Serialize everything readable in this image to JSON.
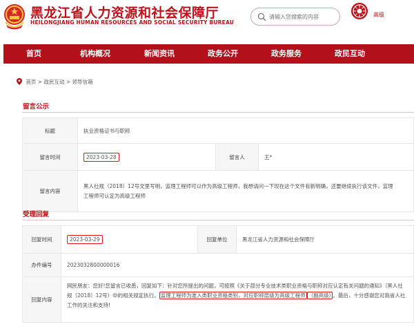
{
  "header": {
    "title": "黑龙江省人力资源和社会保障厅",
    "subtitle": "HEILONGJIANG HUMAN RESOURCES AND SOCIAL SECURITY BUREAU",
    "search_placeholder": "请输入您搜索的内容",
    "seal_label": "高级",
    "accent_color": "#b2111b"
  },
  "nav": {
    "items": [
      "首页",
      "机构概况",
      "新闻资讯",
      "政务公开",
      "政务服务",
      "政民互动"
    ]
  },
  "breadcrumb": {
    "home": "首页",
    "sep1": ">",
    "level1": "政民互动",
    "sep2": ">",
    "level2": "领导信箱"
  },
  "message": {
    "section_title": "留言公示",
    "title_label": "标题",
    "title_value": "执业资格证书与职称",
    "time_label": "留言时间",
    "time_value": "2023-03-28",
    "person_label": "留言人",
    "person_value": "王*",
    "content_label": "留言内容",
    "content_value": "黑人社规（2018）12号文里写明，监理工程师可以作为高级工程师，我想请问一下现在这个文件有新明确，还要继续执行该文件，监理工程师可认定为高级工程师"
  },
  "reply": {
    "section_title": "受理回复",
    "time_label": "回复时间",
    "time_value": "2023-03-29",
    "unit_label": "回复单位",
    "unit_value": "黑龙江省人力资源和社会保障厅",
    "id_label": "办件编号",
    "id_value": "2023032800000016",
    "content_label": "回复内容",
    "content_part1": "网民朋友：您好!您留言已收悉，回复如下：针对您所提出的问题，可按照《关于部分专业技术类职业资格与职称对应认定有关问题的通知》（黑人社规〔2018〕12号）中的相关规定执行。",
    "content_highlight1": "监理工程师为准入类职业资格类别，对应职称层级为高级工程师",
    "content_highlight2": "（副高级）",
    "content_part2": "。最后，十分感谢您对我省人社工作的关注和支持!"
  }
}
